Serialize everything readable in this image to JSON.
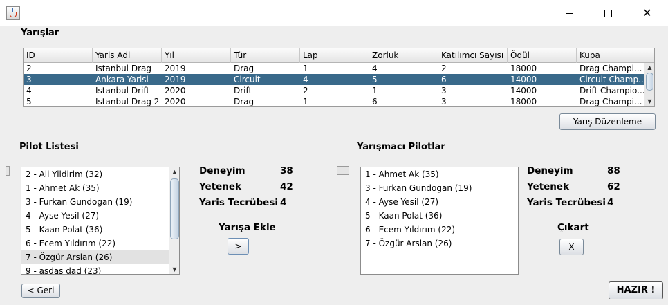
{
  "window": {
    "icon": "java-cup-icon",
    "controls": {
      "minimize": "minimize-icon",
      "maximize": "maximize-icon",
      "close": "✕"
    }
  },
  "races": {
    "section_title": "Yarışlar",
    "columns": [
      "ID",
      "Yaris Adi",
      "Yıl",
      "Tür",
      "Lap",
      "Zorluk",
      "Katılımcı Sayısı",
      "Ödül",
      "Kupa"
    ],
    "rows": [
      [
        "2",
        "Istanbul Drag",
        "2019",
        "Drag",
        "1",
        "4",
        "2",
        "18000",
        "Drag Champi..."
      ],
      [
        "3",
        "Ankara Yarisi",
        "2019",
        "Circuit",
        "4",
        "5",
        "6",
        "14000",
        "Circuit Champ..."
      ],
      [
        "4",
        "Istanbul Drift",
        "2020",
        "Drift",
        "2",
        "1",
        "3",
        "14000",
        "Drift Champio..."
      ],
      [
        "5",
        "Istanbul Drag 2",
        "2020",
        "Drag",
        "1",
        "6",
        "3",
        "18000",
        "Drag Champi..."
      ]
    ],
    "selected_row_index": 1,
    "edit_button": "Yarış Düzenleme"
  },
  "pilots": {
    "title": "Pilot Listesi",
    "items": [
      "2 - Ali Yildirim (32)",
      "1 - Ahmet Ak (35)",
      "3 - Furkan Gundogan (19)",
      "4 - Ayse Yesil (27)",
      "5 - Kaan Polat (36)",
      "6 - Ecem Yıldırım (22)",
      "7 - Özgür Arslan (26)",
      "9 - asdas dad (23)"
    ],
    "highlighted_index": 6,
    "stats": {
      "experience_label": "Deneyim",
      "experience_value": "38",
      "skill_label": "Yetenek",
      "skill_value": "42",
      "race_exp_label": "Yaris Tecrübesi",
      "race_exp_value": "4"
    },
    "add_label": "Yarışa Ekle",
    "add_button": ">"
  },
  "contestants": {
    "title": "Yarışmacı Pilotlar",
    "items": [
      "1 - Ahmet Ak (35)",
      "3 - Furkan Gundogan (19)",
      "4 - Ayse Yesil (27)",
      "5 - Kaan Polat (36)",
      "6 - Ecem Yıldırım (22)",
      "7 - Özgür Arslan (26)"
    ],
    "stats": {
      "experience_label": "Deneyim",
      "experience_value": "88",
      "skill_label": "Yetenek",
      "skill_value": "62",
      "race_exp_label": "Yaris Tecrübesi",
      "race_exp_value": "4"
    },
    "remove_label": "Çıkart",
    "remove_button": "X"
  },
  "footer": {
    "back_button": "< Geri",
    "ready_button": "HAZIR !"
  },
  "colors": {
    "selected_row": "#39698a",
    "background": "#eeeeee"
  }
}
